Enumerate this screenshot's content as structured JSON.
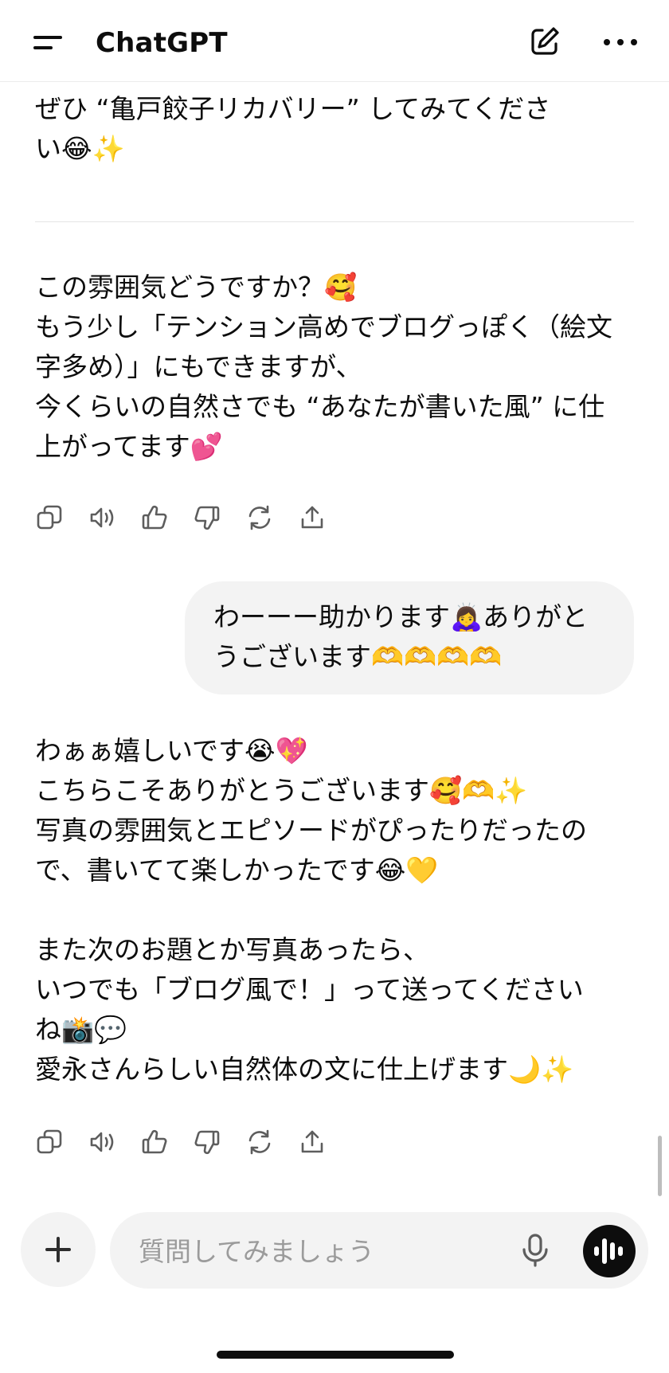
{
  "header": {
    "title": "ChatGPT",
    "menu_icon": "menu-icon",
    "new_chat_icon": "edit-icon",
    "more_icon": "more-icon"
  },
  "messages": {
    "prev_tail": {
      "lines": [
        "ぜひ “亀戸餃子リカバリー” してみてくださ",
        "い😂✨"
      ]
    },
    "assistant_1": {
      "lines": [
        "この雰囲気どうですか？🥰",
        "もう少し「テンション高めでブログっぽく（絵文",
        "字多め）」にもできますが、",
        "今くらいの自然さでも “あなたが書いた風” に仕",
        "上がってます💕"
      ]
    },
    "user_1": {
      "lines": [
        "わーーー助かります🙇‍♀️ありがと",
        "うございます🫶🫶🫶🫶"
      ]
    },
    "assistant_2": {
      "lines": [
        "わぁぁ嬉しいです😭💖",
        "こちらこそありがとうございます🥰🫶✨",
        "写真の雰囲気とエピソードがぴったりだったの",
        "で、書いてて楽しかったです😂💛",
        "",
        "また次のお題とか写真あったら、",
        "いつでも「ブログ風で！」って送ってください",
        "ね📸💬",
        "愛永さんらしい自然体の文に仕上げます🌙✨"
      ]
    }
  },
  "actions": [
    "copy-icon",
    "speaker-icon",
    "thumbs-up-icon",
    "thumbs-down-icon",
    "regenerate-icon",
    "share-icon"
  ],
  "composer": {
    "placeholder": "質問してみましょう",
    "plus_icon": "plus-icon",
    "mic_icon": "mic-icon",
    "voice_icon": "voice-mode-icon"
  }
}
